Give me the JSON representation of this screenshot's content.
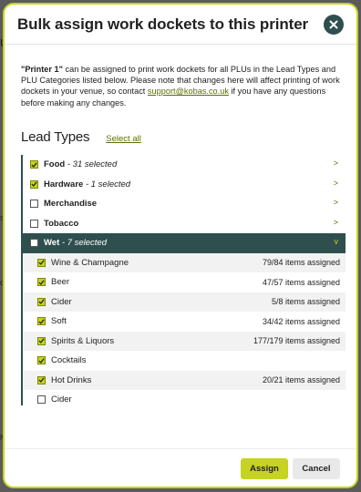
{
  "dialog": {
    "title": "Bulk assign work dockets to this printer",
    "intro": {
      "printer_name": "\"Printer 1\"",
      "text_before_link": " can be assigned to print work dockets for all PLUs in the Lead Types and PLU Categories listed below. Please note that changes here will affect printing of work dockets in your venue, so contact ",
      "link": "support@kobas.co.uk",
      "text_after_link": " if you have any questions before making any changes."
    },
    "section_title": "Lead Types",
    "select_all": "Select all",
    "lead_types": [
      {
        "name": "Food",
        "sub": " - 31 selected",
        "checked": true
      },
      {
        "name": "Hardware",
        "sub": " - 1 selected",
        "checked": true
      },
      {
        "name": "Merchandise",
        "sub": "",
        "checked": false
      },
      {
        "name": "Tobacco",
        "sub": "",
        "checked": false
      },
      {
        "name": "Wet",
        "sub": " - 7 selected",
        "checked": false
      }
    ],
    "wet_children": [
      {
        "name": "Wine & Champagne",
        "count": "79/84 items assigned",
        "checked": true
      },
      {
        "name": "Beer",
        "count": "47/57 items assigned",
        "checked": true
      },
      {
        "name": "Cider",
        "count": "5/8 items assigned",
        "checked": true
      },
      {
        "name": "Soft",
        "count": "34/42 items assigned",
        "checked": true
      },
      {
        "name": "Spirits & Liquors",
        "count": "177/179 items assigned",
        "checked": true
      },
      {
        "name": "Cocktails",
        "count": "",
        "checked": true
      },
      {
        "name": "Hot Drinks",
        "count": "20/21 items assigned",
        "checked": true
      },
      {
        "name": "Cider",
        "count": "",
        "checked": false
      }
    ],
    "chevron_right": ">",
    "chevron_down": "v",
    "assign_label": "Assign",
    "cancel_label": "Cancel"
  },
  "colors": {
    "accent": "#c6d320",
    "dark": "#2f4f4f",
    "link": "#5a6e00"
  },
  "background_fragments": [
    "u",
    "s",
    "ov",
    "lw"
  ]
}
